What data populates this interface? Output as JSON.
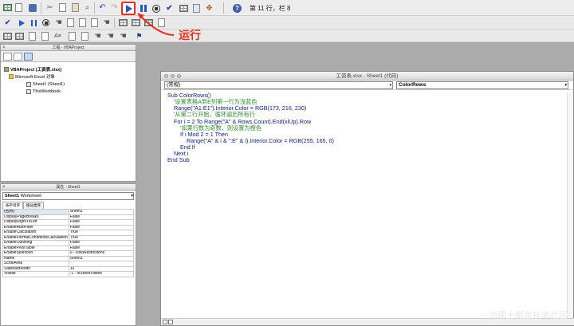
{
  "toolbar": {
    "row1_icons": [
      "excel-icon",
      "dropdown-arrow-icon",
      "save-icon",
      "cut-icon",
      "copy-icon",
      "paste-icon",
      "find-icon",
      "undo-icon",
      "redo-icon",
      "run-icon",
      "break-icon",
      "reset-icon",
      "design-mode-icon",
      "project-explorer-icon",
      "properties-icon",
      "object-browser-icon",
      "help-icon"
    ],
    "position_label": "第 11 行，栏 8",
    "annotation": "运行",
    "annotation_color": "#e2321e"
  },
  "project_panel": {
    "title": "工程 - VBAProject",
    "items": [
      {
        "label": "VBAProject (工资表.xlsx)",
        "level": 0
      },
      {
        "label": "Microsoft Excel 对象",
        "level": 1
      },
      {
        "label": "Sheet1 (Sheet1)",
        "level": 2
      },
      {
        "label": "ThisWorkbook",
        "level": 2
      }
    ]
  },
  "properties_panel": {
    "title": "属性 - Sheet1",
    "object_name": "Sheet1",
    "object_type": "Worksheet",
    "tabs": [
      "按字母序",
      "按分类序"
    ],
    "rows": [
      [
        "(名称)",
        "Sheet1"
      ],
      [
        "DisplayPageBreaks",
        "False"
      ],
      [
        "DisplayRightToLeft",
        "False"
      ],
      [
        "EnableAutoFilter",
        "False"
      ],
      [
        "EnableCalculation",
        "True"
      ],
      [
        "EnableFormatConditionsCalculation",
        "True"
      ],
      [
        "EnableOutlining",
        "False"
      ],
      [
        "EnablePivotTable",
        "False"
      ],
      [
        "EnableSelection",
        "0 - xlNoRestrictions"
      ],
      [
        "Name",
        "Sheet1"
      ],
      [
        "ScrollArea",
        ""
      ],
      [
        "StandardWidth",
        "10"
      ],
      [
        "Visible",
        "-1 - xlSheetVisible"
      ]
    ]
  },
  "code_window": {
    "title": "工资表.xlsx - Sheet1 (代码)",
    "object_combo": "(常规)",
    "procedure_combo": "ColorRows",
    "lines": [
      {
        "text": "Sub ColorRows()",
        "kind": "kw"
      },
      {
        "text": "    '设置表格A到E列第一行为浅蓝色",
        "kind": "cm"
      },
      {
        "text": "    Range(\"A1:E1\").Interior.Color = RGB(173, 216, 230)",
        "kind": "code"
      },
      {
        "text": "    '从第二行开始，循环遍历所有行",
        "kind": "cm"
      },
      {
        "text": "    For i = 2 To Range(\"A\" & Rows.Count).End(xlUp).Row",
        "kind": "code"
      },
      {
        "text": "        '如果行数为奇数，则设置为橙色",
        "kind": "cm"
      },
      {
        "text": "        If i Mod 2 = 1 Then",
        "kind": "code"
      },
      {
        "text": "            Range(\"A\" & i & \":E\" & i).Interior.Color = RGB(255, 165, 0)",
        "kind": "code"
      },
      {
        "text": "        End If",
        "kind": "code"
      },
      {
        "text": "    Next i",
        "kind": "code"
      },
      {
        "text": "End Sub",
        "kind": "kw"
      }
    ]
  },
  "watermark": "@稀土掘金技术社区"
}
